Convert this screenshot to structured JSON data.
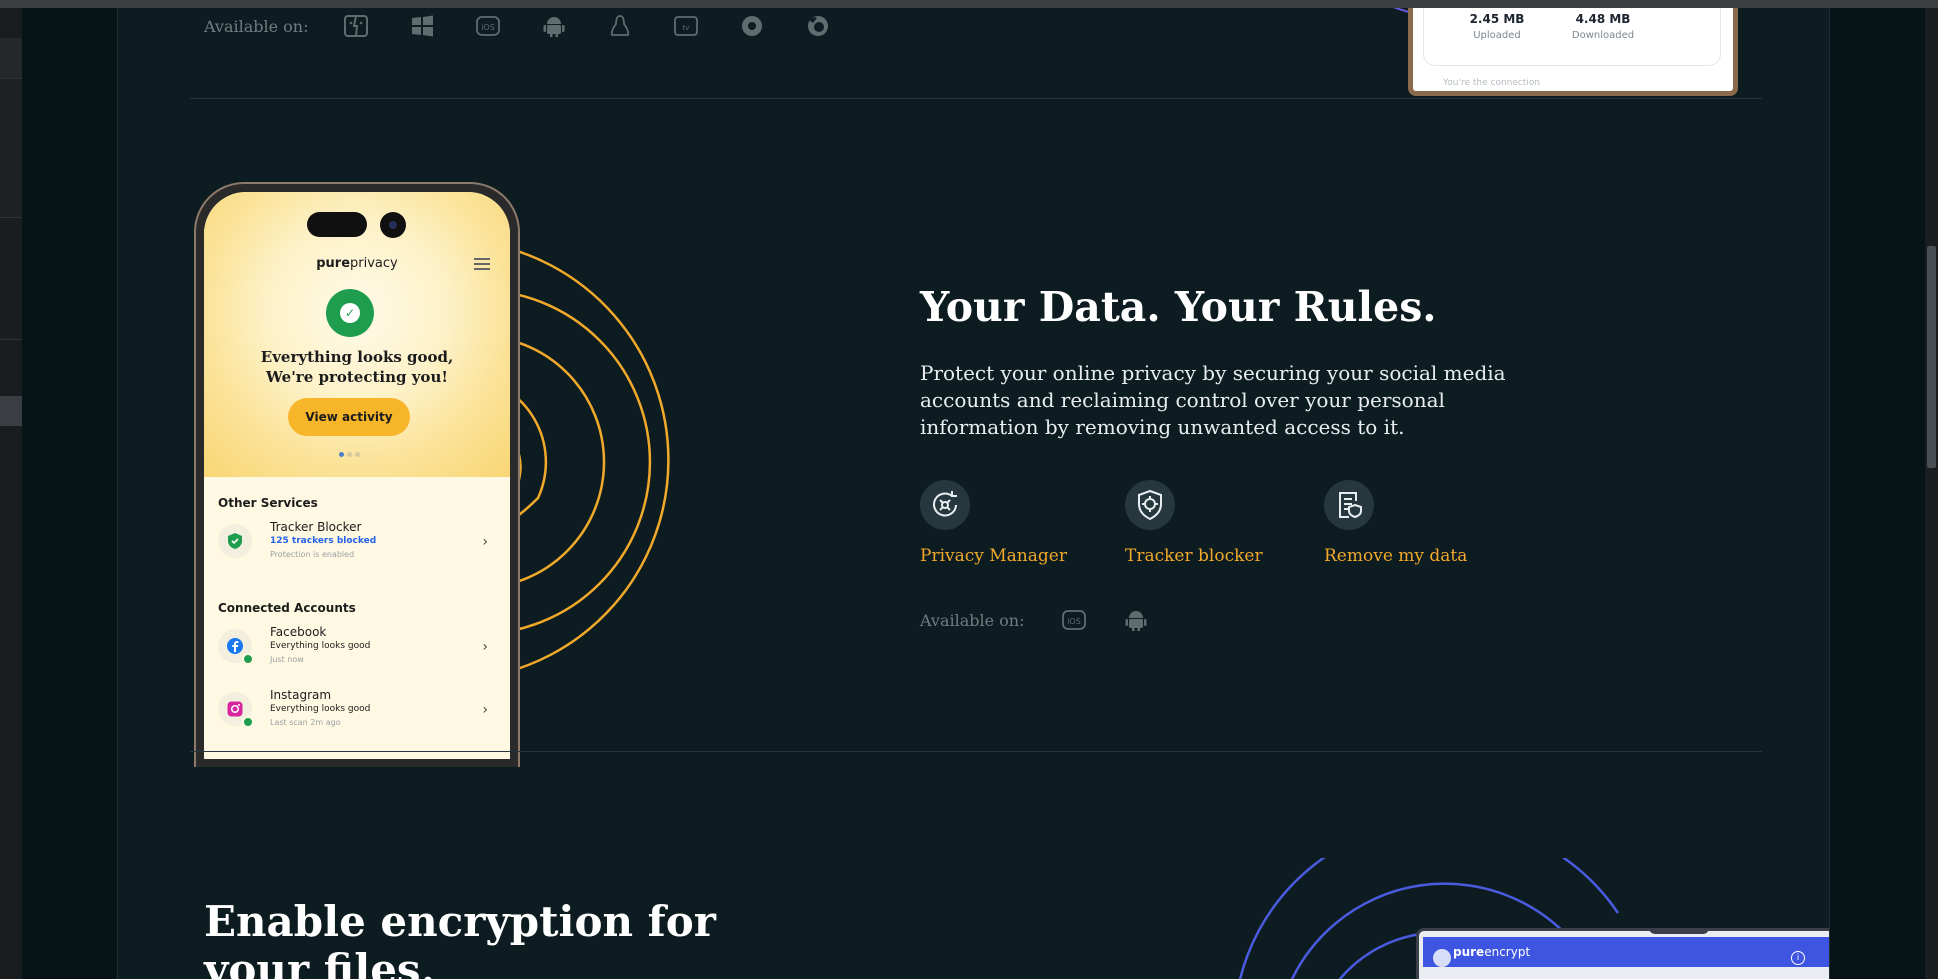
{
  "top_section": {
    "available_label": "Available on:",
    "platforms": [
      "finder-icon",
      "windows-icon",
      "ios-icon",
      "android-icon",
      "linux-icon",
      "appletv-icon",
      "chrome-icon",
      "firefox-icon"
    ],
    "stats": [
      {
        "value": "2.45 MB",
        "label": "Uploaded"
      },
      {
        "value": "4.48 MB",
        "label": "Downloaded"
      }
    ],
    "ghost_text": "You're the connection"
  },
  "phone": {
    "brand_bold": "pure",
    "brand_rest": "privacy",
    "headline_line1": "Everything looks good,",
    "headline_line2": "We're protecting you!",
    "view_button": "View activity",
    "other_services_title": "Other Services",
    "tracker": {
      "title": "Tracker Blocker",
      "sub": "125 trackers blocked",
      "meta": "Protection is enabled"
    },
    "connected_title": "Connected Accounts",
    "facebook": {
      "title": "Facebook",
      "sub": "Everything looks good",
      "meta": "Just now"
    },
    "instagram": {
      "title": "Instagram",
      "sub": "Everything looks good",
      "meta": "Last scan 2m ago"
    }
  },
  "main": {
    "title": "Your Data. Your Rules.",
    "description": "Protect your online privacy by securing your social media accounts and reclaiming control over your personal information by removing unwanted access to it.",
    "features": [
      {
        "label": "Privacy Manager",
        "icon": "privacy-manager-icon"
      },
      {
        "label": "Tracker blocker",
        "icon": "tracker-blocker-icon"
      },
      {
        "label": "Remove my data",
        "icon": "remove-data-icon"
      }
    ],
    "available_label": "Available on:",
    "platforms": [
      "ios-icon",
      "android-icon"
    ]
  },
  "next_section": {
    "title_line1": "Enable encryption for",
    "title_line2": "your files.",
    "app_brand_bold": "pure",
    "app_brand_rest": "encrypt"
  },
  "colors": {
    "accent_orange": "#f1a92b",
    "arc_purple": "#6b5ae0",
    "arc_blue": "#4a5be0",
    "background": "#0d1c21"
  }
}
